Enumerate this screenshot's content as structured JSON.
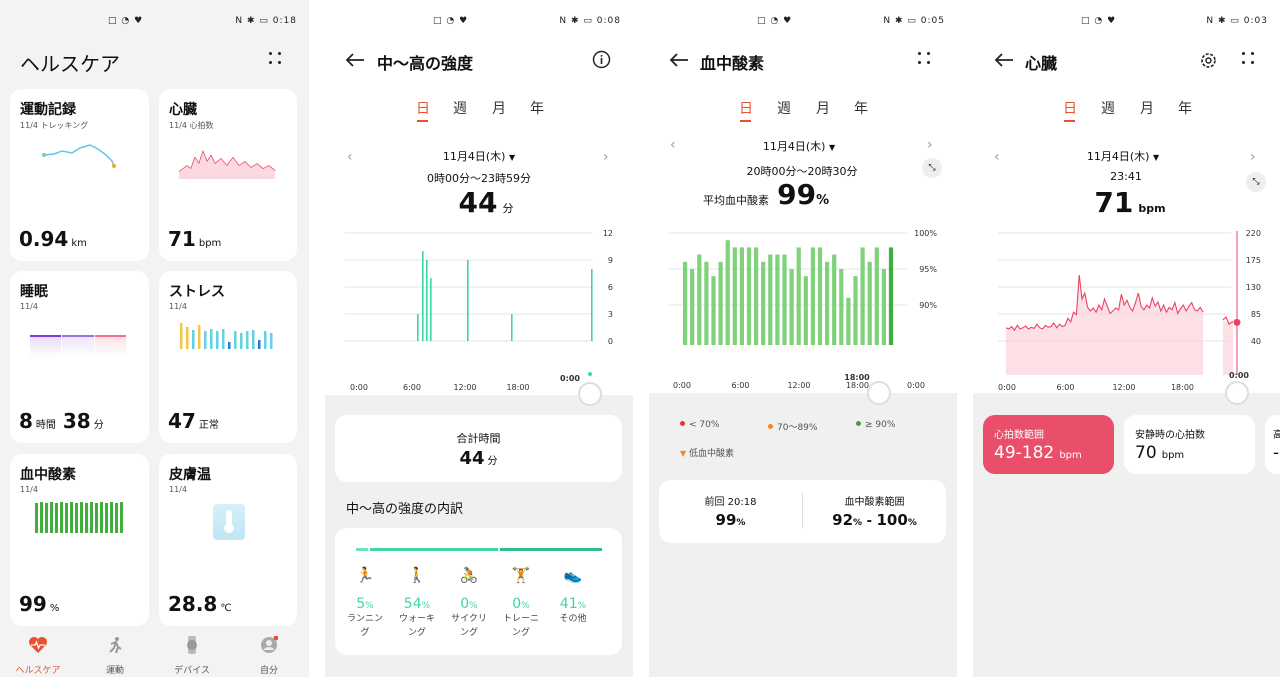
{
  "status": {
    "p1": {
      "left": "□ ◔ ♥",
      "right": "N ✱ ▭ 0:18"
    },
    "p2": {
      "left": "□ ◔ ♥",
      "right": "N ✱ ▭ 0:08"
    },
    "p3": {
      "left": "□ ◔ ♥",
      "right": "N ✱ ▭ 0:05"
    },
    "p4": {
      "left": "□ ◔ ♥",
      "right": "N ✱ ▭ 0:03"
    }
  },
  "home": {
    "title": "ヘルスケア",
    "cards": [
      {
        "title": "運動記録",
        "sub": "11/4 トレッキング",
        "value": "0.94",
        "unit": "km"
      },
      {
        "title": "心臓",
        "sub": "11/4 心拍数",
        "value": "71",
        "unit": "bpm"
      },
      {
        "title": "睡眠",
        "sub": "11/4",
        "value_a": "8",
        "unit_a": "時間",
        "value_b": "38",
        "unit_b": "分"
      },
      {
        "title": "ストレス",
        "sub": "11/4",
        "value": "47",
        "unit": "正常"
      },
      {
        "title": "血中酸素",
        "sub": "11/4",
        "value": "99",
        "unit": "%"
      },
      {
        "title": "皮膚温",
        "sub": "11/4",
        "value": "28.8",
        "unit": "℃"
      }
    ],
    "nav": [
      {
        "label": "ヘルスケア",
        "icon": "heart-icon",
        "active": true
      },
      {
        "label": "運動",
        "icon": "running-icon",
        "active": false
      },
      {
        "label": "デバイス",
        "icon": "watch-icon",
        "active": false
      },
      {
        "label": "自分",
        "icon": "profile-icon",
        "active": false
      }
    ],
    "accent": "#e8502e"
  },
  "tabs": [
    "日",
    "週",
    "月",
    "年"
  ],
  "intensity": {
    "title": "中〜高の強度",
    "date": "11月4日(木)",
    "range": "0時00分〜23時59分",
    "value": "44",
    "unit": "分",
    "y_ticks": [
      "12",
      "9",
      "6",
      "3",
      "0"
    ],
    "x_ticks": [
      "0:00",
      "6:00",
      "12:00",
      "18:00"
    ],
    "cursor_time": "0:00",
    "total_label": "合計時間",
    "total_value": "44",
    "total_unit": "分",
    "breakdown_title": "中〜高の強度の内訳",
    "activities": [
      {
        "name": "ランニング",
        "pct": "5",
        "icon": "running-icon"
      },
      {
        "name": "ウォーキング",
        "pct": "54",
        "icon": "walking-icon"
      },
      {
        "name": "サイクリング",
        "pct": "0",
        "icon": "cycling-icon"
      },
      {
        "name": "トレーニング",
        "pct": "0",
        "icon": "training-icon"
      },
      {
        "name": "その他",
        "pct": "41",
        "icon": "shoe-icon"
      }
    ],
    "color": "#3fd6a6"
  },
  "spo2": {
    "title": "血中酸素",
    "date": "11月4日(木)",
    "range": "20時00分〜20時30分",
    "avg_label": "平均血中酸素",
    "avg_value": "99",
    "avg_unit": "%",
    "y_ticks": [
      "100%",
      "95%",
      "90%"
    ],
    "x_ticks": [
      "0:00",
      "6:00",
      "12:00",
      "18:00",
      "0:00"
    ],
    "cursor_time": "18:00",
    "legend": [
      {
        "label": "< 70%",
        "color": "#e53935"
      },
      {
        "label": "70〜89%",
        "color": "#f08a24"
      },
      {
        "label": "≥ 90%",
        "color": "#43a047"
      }
    ],
    "low_label": "低血中酸素",
    "prev_label": "前回 20:18",
    "prev_value": "99",
    "prev_unit": "%",
    "range_label": "血中酸素範囲",
    "range_min": "92",
    "range_max": "100",
    "range_unit": "%",
    "range_sep": " - ",
    "color": "#7fd17a"
  },
  "heart": {
    "title": "心臓",
    "date": "11月4日(木)",
    "time": "23:41",
    "value": "71",
    "unit": "bpm",
    "y_ticks": [
      "220",
      "175",
      "130",
      "85",
      "40"
    ],
    "x_ticks": [
      "0:00",
      "6:00",
      "12:00",
      "18:00"
    ],
    "cursor_time": "0:00",
    "range_label": "心拍数範囲",
    "range_value": "49-182",
    "range_unit": "bpm",
    "rest_label": "安静時の心拍数",
    "rest_value": "70",
    "rest_unit": "bpm",
    "next_label": "高",
    "next_value": "-",
    "color": "#e94463"
  }
}
